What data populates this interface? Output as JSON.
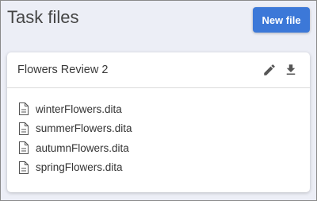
{
  "header": {
    "title": "Task files",
    "new_file_label": "New file"
  },
  "card": {
    "title": "Flowers Review 2",
    "actions": [
      "edit-icon",
      "download-icon"
    ],
    "files": [
      {
        "name": "winterFlowers.dita",
        "icon": "file-icon"
      },
      {
        "name": "summerFlowers.dita",
        "icon": "file-icon"
      },
      {
        "name": "autumnFlowers.dita",
        "icon": "file-icon"
      },
      {
        "name": "springFlowers.dita",
        "icon": "file-icon"
      }
    ]
  },
  "colors": {
    "background": "#eceef6",
    "primary_button": "#3c78d8",
    "icon": "#555555"
  }
}
